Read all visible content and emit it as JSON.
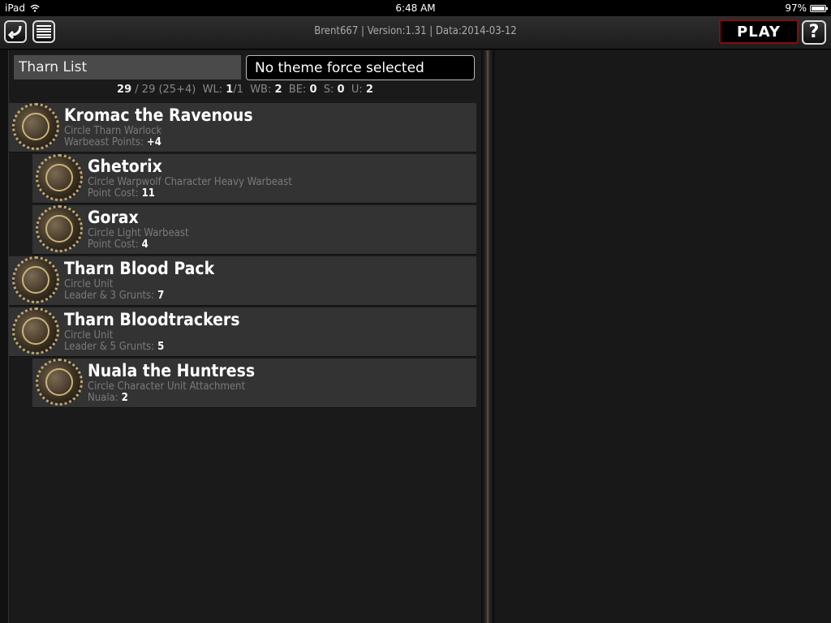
{
  "status_bar": {
    "device": "iPad",
    "time": "6:48 AM",
    "battery": "97%",
    "battery_level": 0.97
  },
  "top_bar": {
    "title": "Brent667 | Version:1.31 | Data:2014-03-12",
    "play_label": "PLAY",
    "help_label": "?"
  },
  "list": {
    "title": "Tharn List",
    "theme_force": "No theme force selected",
    "stats": {
      "points": "29",
      "points_total": "/ 29 (25+4)",
      "wl_label": "WL:",
      "wl_value": "1",
      "wl_total": "/1",
      "wb_label": "WB:",
      "wb_value": "2",
      "be_label": "BE:",
      "be_value": "0",
      "s_label": "S:",
      "s_value": "0",
      "u_label": "U:",
      "u_value": "2"
    },
    "entries": [
      {
        "name": "Kromac the Ravenous",
        "subtitle": "Circle Tharn Warlock",
        "meta_label": "Warbeast Points:",
        "meta_value": "+4"
      },
      {
        "name": "Ghetorix",
        "subtitle": "Circle Warpwolf Character Heavy Warbeast",
        "meta_label": "Point Cost:",
        "meta_value": "11"
      },
      {
        "name": "Gorax",
        "subtitle": "Circle Light Warbeast",
        "meta_label": "Point Cost:",
        "meta_value": "4"
      },
      {
        "name": "Tharn Blood Pack",
        "subtitle": "Circle Unit",
        "meta_label": "Leader & 3 Grunts:",
        "meta_value": "7"
      },
      {
        "name": "Tharn Bloodtrackers",
        "subtitle": "Circle Unit",
        "meta_label": "Leader & 5 Grunts:",
        "meta_value": "5"
      },
      {
        "name": "Nuala the Huntress",
        "subtitle": "Circle Character Unit Attachment",
        "meta_label": "Nuala:",
        "meta_value": "2"
      }
    ]
  },
  "icons": {
    "back": "back-arrow-icon",
    "menu": "menu-list-icon",
    "help": "help-question-icon",
    "wifi": "wifi-icon",
    "battery": "battery-icon"
  },
  "colors": {
    "play_border": "#8a0a0a",
    "background": "#111111",
    "entry_background": "#333333"
  }
}
